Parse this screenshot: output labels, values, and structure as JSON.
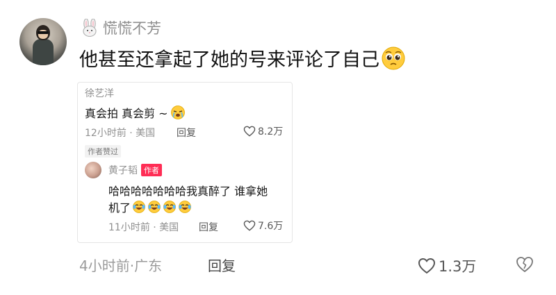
{
  "comment": {
    "username": "慌慌不芳",
    "text": "他甚至还拿起了她的号来评论了自己",
    "time_location": "4小时前·广东",
    "reply_label": "回复",
    "likes": "1.3万"
  },
  "quoted": {
    "username": "徐艺洋",
    "text": "真会拍 真会剪 ~",
    "meta": "12小时前 · 美国",
    "reply_label": "回复",
    "likes": "8.2万",
    "author_liked": "作者赞过",
    "reply": {
      "username": "黄子韬",
      "author_tag": "作者",
      "text_line1": "哈哈哈哈哈哈哈我真醉了 谁拿她",
      "text_line2": "机了",
      "meta": "11小时前 · 美国",
      "reply_label": "回复",
      "likes": "7.6万"
    }
  },
  "colors": {
    "author_tag_bg": "#ff2d55",
    "muted_text": "#8f8f8f"
  }
}
